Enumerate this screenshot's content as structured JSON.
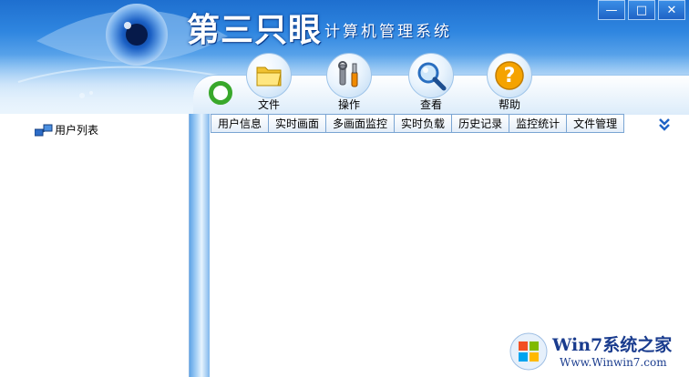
{
  "app": {
    "brand": "第三只眼",
    "subtitle": "计算机管理系统"
  },
  "window_controls": {
    "minimize": "—",
    "maximize": "□",
    "close": "✕"
  },
  "toolbar": {
    "items": [
      {
        "label": "文件",
        "icon": "folder-icon"
      },
      {
        "label": "操作",
        "icon": "tools-icon"
      },
      {
        "label": "查看",
        "icon": "magnifier-icon"
      },
      {
        "label": "帮助",
        "icon": "help-icon"
      }
    ]
  },
  "sidebar": {
    "tree": [
      {
        "label": "用户列表",
        "icon": "network-icon"
      }
    ]
  },
  "tabs": [
    {
      "label": "用户信息"
    },
    {
      "label": "实时画面"
    },
    {
      "label": "多画面监控"
    },
    {
      "label": "实时负载"
    },
    {
      "label": "历史记录"
    },
    {
      "label": "监控统计"
    },
    {
      "label": "文件管理"
    }
  ],
  "tabs_more_icon": "double-chevron-down-icon",
  "watermark": {
    "line1": "Win7系统之家",
    "line2": "Www.Winwin7.com"
  },
  "colors": {
    "accent": "#1e6fcf",
    "brand_dark": "#1a3c8e",
    "green": "#39a82b",
    "help_orange": "#f5a300"
  }
}
